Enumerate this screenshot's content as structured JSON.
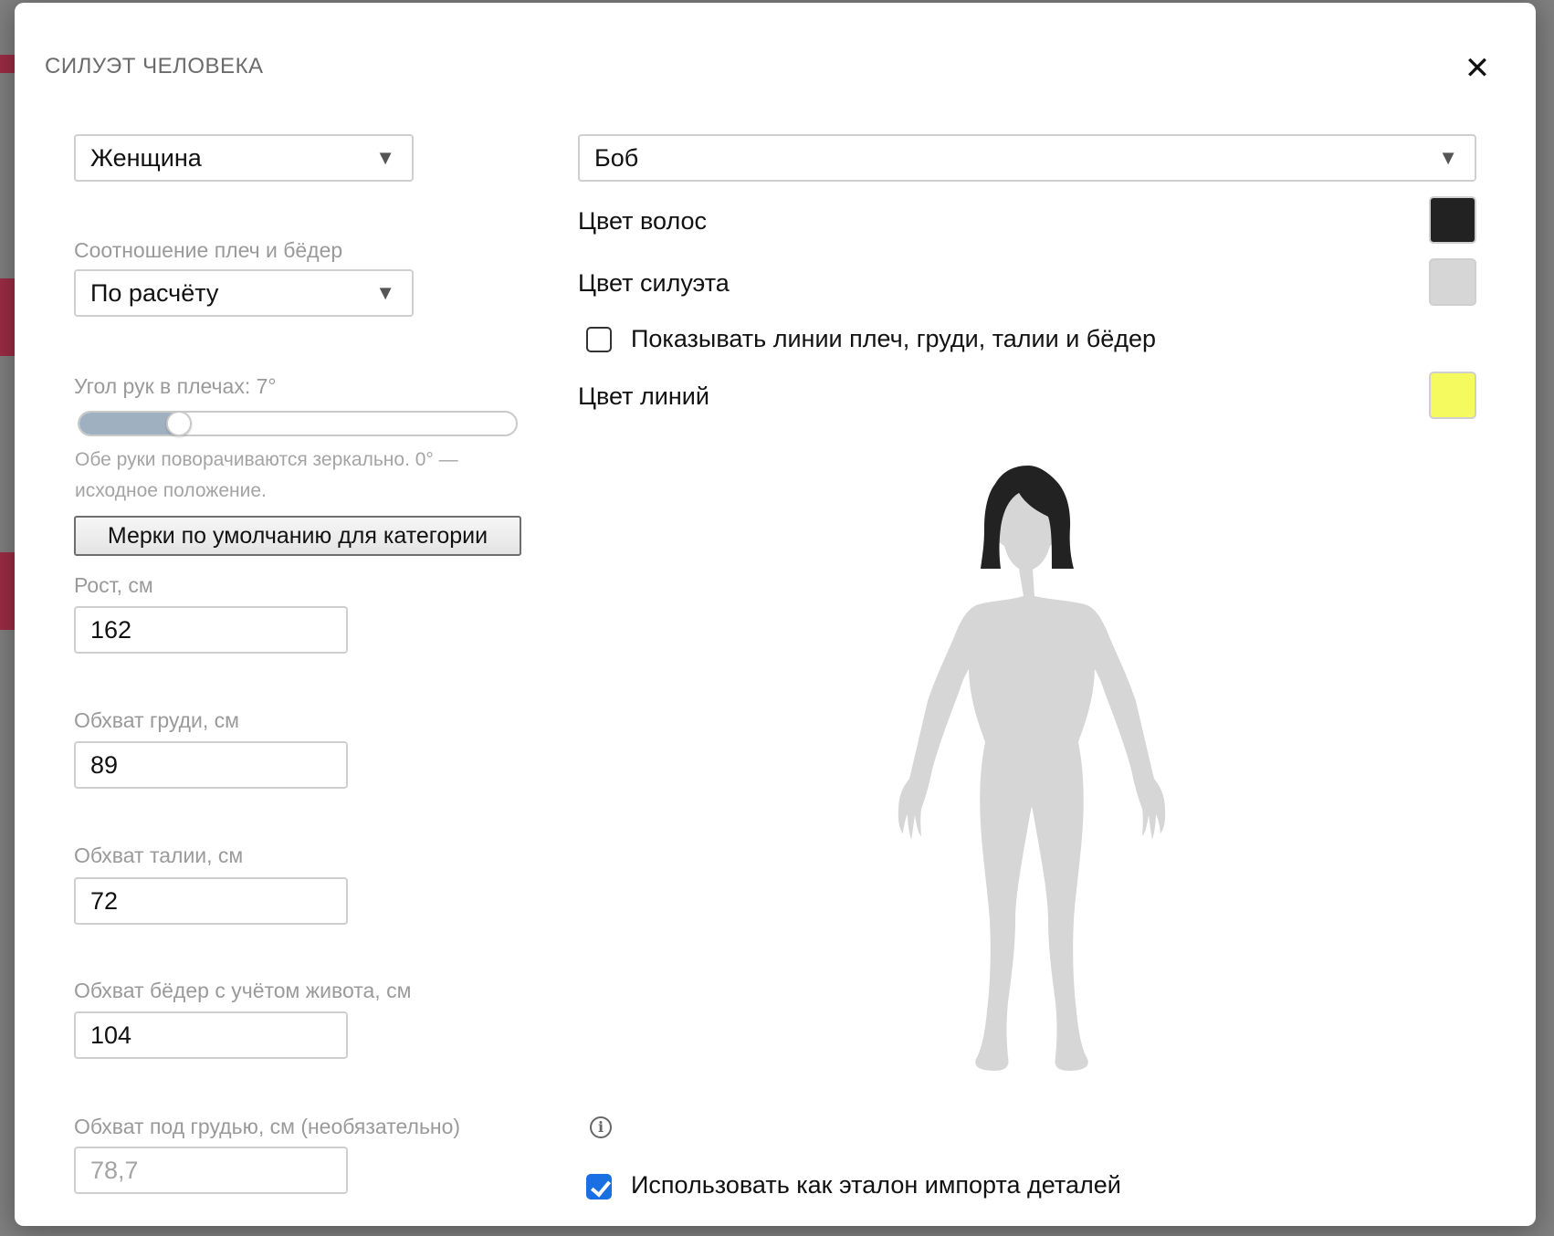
{
  "modal": {
    "title": "СИЛУЭТ ЧЕЛОВЕКА",
    "close_icon": "close-icon"
  },
  "left": {
    "gender_select": {
      "value": "Женщина"
    },
    "ratio": {
      "label": "Соотношение плеч и бёдер",
      "value": "По расчёту"
    },
    "arm_angle": {
      "label": "Угол рук в плечах: 7°",
      "value_fraction": 0.23,
      "help": "Обе руки поворачиваются зеркально. 0° — исходное положение."
    },
    "defaults_button": "Мерки по умолчанию для категории",
    "height": {
      "label": "Рост, см",
      "value": "162"
    },
    "chest": {
      "label": "Обхват груди, см",
      "value": "89"
    },
    "waist": {
      "label": "Обхват талии, см",
      "value": "72"
    },
    "hips": {
      "label": "Обхват бёдер с учётом живота, см",
      "value": "104"
    },
    "underbust": {
      "label": "Обхват под грудью, см (необязательно)",
      "placeholder": "78,7"
    }
  },
  "right": {
    "hairstyle_select": {
      "value": "Боб"
    },
    "hair_color": {
      "label": "Цвет волос",
      "color": "#222222"
    },
    "silhouette_color": {
      "label": "Цвет силуэта",
      "color": "#d6d6d6"
    },
    "show_lines": {
      "label": "Показывать линии плеч, груди, талии и бёдер",
      "checked": false
    },
    "lines_color": {
      "label": "Цвет линий",
      "color": "#f5fa5e"
    },
    "use_as_reference": {
      "label": "Использовать как эталон импорта деталей",
      "checked": true
    }
  },
  "colors": {
    "accent": "#1a6fe3",
    "muted_text": "#9a9a9a"
  }
}
